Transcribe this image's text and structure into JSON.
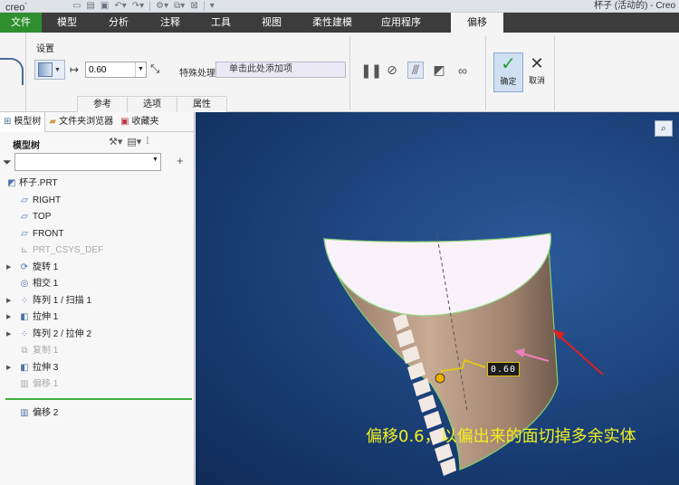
{
  "titlebar": {
    "logo": "creo",
    "window_title": "杯子 (活动的) - Creo"
  },
  "ribbon_tabs": [
    "文件",
    "模型",
    "分析",
    "注释",
    "工具",
    "视图",
    "柔性建模",
    "应用程序",
    "偏移"
  ],
  "ribbon": {
    "group_label": "设置",
    "offset_value": "0.60",
    "special_label": "特殊处理",
    "collector_text": "单击此处添加项",
    "subtabs": [
      "参考",
      "选项",
      "属性"
    ],
    "ok_label": "确定",
    "cancel_label": "取消"
  },
  "panel": {
    "tabs": [
      "模型树",
      "文件夹浏览器",
      "收藏夹"
    ],
    "tree_header": "模型树",
    "filter_value": "",
    "tree": [
      {
        "label": "杯子.PRT",
        "icon": "part-icon",
        "dim": false,
        "expander": false,
        "indent": 0
      },
      {
        "label": "RIGHT",
        "icon": "datum-plane-icon",
        "dim": false,
        "expander": false,
        "indent": 1
      },
      {
        "label": "TOP",
        "icon": "datum-plane-icon",
        "dim": false,
        "expander": false,
        "indent": 1
      },
      {
        "label": "FRONT",
        "icon": "datum-plane-icon",
        "dim": false,
        "expander": false,
        "indent": 1
      },
      {
        "label": "PRT_CSYS_DEF",
        "icon": "csys-icon",
        "dim": true,
        "expander": false,
        "indent": 1
      },
      {
        "label": "旋转 1",
        "icon": "revolve-icon",
        "dim": false,
        "expander": true,
        "indent": 1
      },
      {
        "label": "相交 1",
        "icon": "intersect-icon",
        "dim": false,
        "expander": false,
        "indent": 1
      },
      {
        "label": "阵列 1 / 扫描 1",
        "icon": "pattern-icon",
        "dim": false,
        "expander": true,
        "indent": 1
      },
      {
        "label": "拉伸 1",
        "icon": "extrude-icon",
        "dim": false,
        "expander": true,
        "indent": 1
      },
      {
        "label": "阵列 2 / 拉伸 2",
        "icon": "pattern-icon",
        "dim": false,
        "expander": true,
        "indent": 1
      },
      {
        "label": "复制 1",
        "icon": "copy-icon",
        "dim": true,
        "expander": false,
        "indent": 1
      },
      {
        "label": "拉伸 3",
        "icon": "extrude-icon",
        "dim": false,
        "expander": true,
        "indent": 1
      },
      {
        "label": "偏移 1",
        "icon": "offset-icon",
        "dim": true,
        "expander": false,
        "indent": 1
      },
      {
        "label": "偏移 2",
        "icon": "offset-icon",
        "dim": false,
        "expander": false,
        "indent": 1
      }
    ]
  },
  "viewport": {
    "dimension_value": "0.60",
    "annotation": "偏移0.6，以偏出来的面切掉多余实体"
  },
  "colors": {
    "file_tab": "#2f8f2f",
    "viewport_bg": "#1a3f77",
    "annotation_text": "#f0f020",
    "model_surface": "#b89b82",
    "arrow_red": "#e02020",
    "arrow_pink": "#f080c0"
  }
}
